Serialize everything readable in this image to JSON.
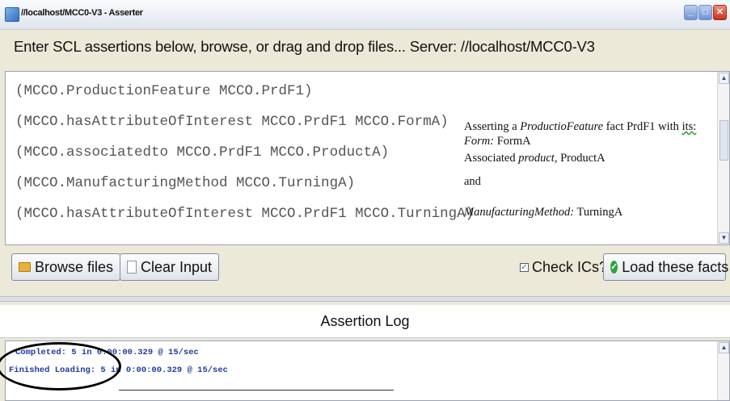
{
  "window": {
    "title": "//localhost/MCC0-V3 - Asserter"
  },
  "instructions": {
    "text": "Enter SCL assertions below, browse, or drag and drop files... Server: //localhost/MCC0-V3"
  },
  "editor": {
    "lines": [
      "(MCCO.ProductionFeature MCCO.PrdF1)",
      "(MCCO.hasAttributeOfInterest MCCO.PrdF1 MCCO.FormA)",
      "(MCCO.associatedto MCCO.PrdF1 MCCO.ProductA)",
      "(MCCO.ManufacturingMethod MCCO.TurningA)",
      "(MCCO.hasAttributeOfInterest MCCO.PrdF1 MCCO.TurningA)"
    ]
  },
  "annotation": {
    "line1_pre": "Asserting a ",
    "line1_it": "ProductioFeature",
    "line1_mid": " fact PrdF1 with ",
    "line1_spell": "its:",
    "line2_it": "Form:",
    "line2_rest": " FormA",
    "line3_pre": "Associated ",
    "line3_it": "product,",
    "line3_rest": " ProductA",
    "line4": "and",
    "line5_it": "ManufacturingMethod:",
    "line5_rest": " TurningA"
  },
  "toolbar": {
    "browse_label": "Browse files",
    "clear_label": "Clear Input",
    "check_label": "Check ICs?",
    "check_checked": true,
    "load_label": "Load these facts"
  },
  "log": {
    "title": "Assertion Log",
    "lines": [
      "Completed: 5 in 0:00:00.329 @ 15/sec",
      "Finished Loading: 5 in 0:00:00.329 @ 15/sec"
    ]
  },
  "colors": {
    "log_text": "#1f3c9e",
    "load_icon": "#2ea43a"
  }
}
